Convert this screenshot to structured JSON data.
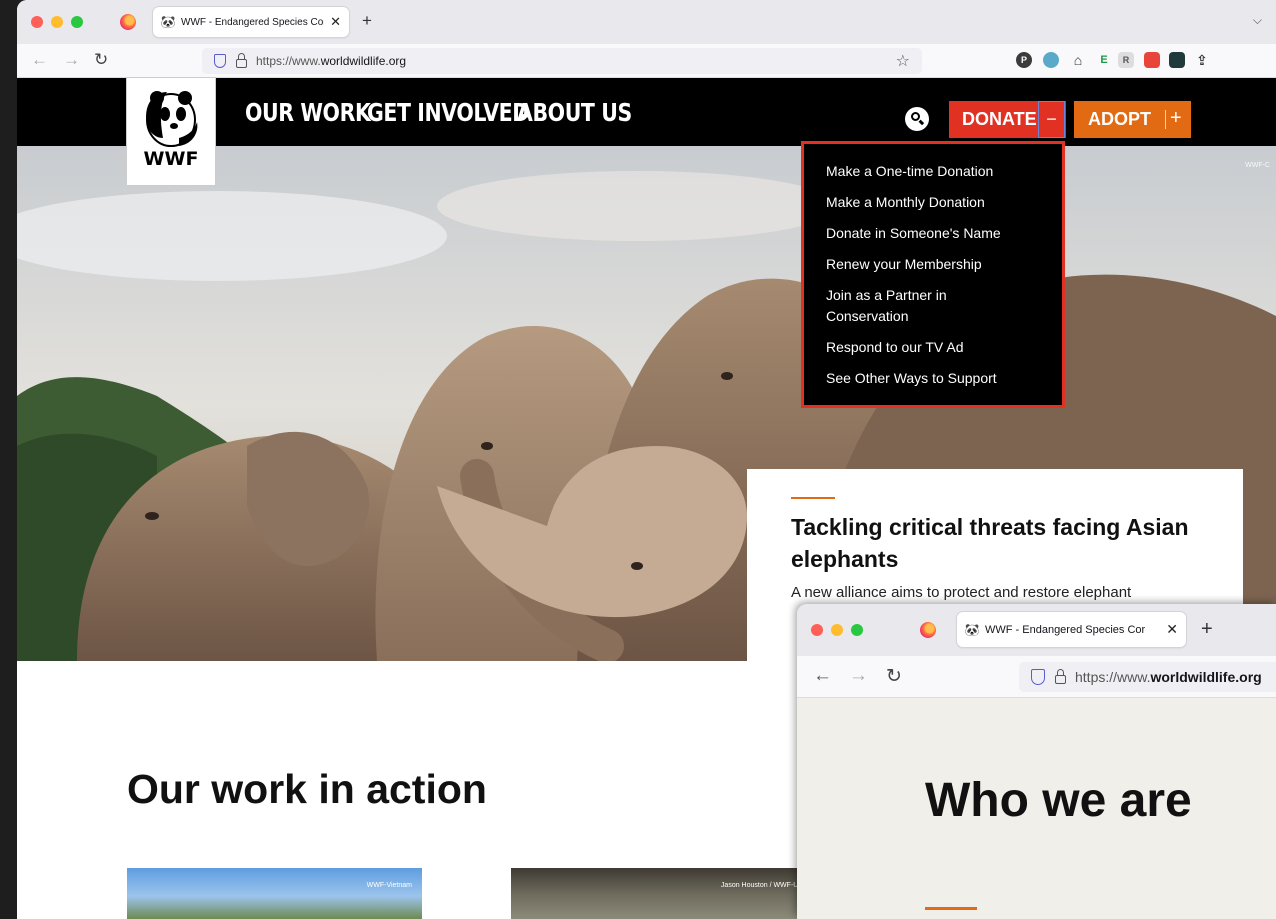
{
  "browser": {
    "tab_title": "WWF - Endangered Species Cor",
    "url_prefix": "https://www.",
    "url_domain": "worldwildlife.org"
  },
  "site": {
    "logo_text": "WWF",
    "nav": [
      "OUR WORK",
      "GET INVOLVED",
      "ABOUT US"
    ],
    "donate_label": "DONATE",
    "donate_toggle": "−",
    "adopt_label": "ADOPT",
    "adopt_toggle": "+",
    "hero_credit": "WWF-C",
    "donate_menu": [
      "Make a One-time Donation",
      "Make a Monthly Donation",
      "Donate in Someone's Name",
      "Renew your Membership",
      "Join as a Partner in Conservation",
      "Respond to our TV Ad",
      "See Other Ways to Support"
    ],
    "feature": {
      "title": "Tackling critical threats facing Asian elephants",
      "description": "A new alliance aims to protect and restore elephant"
    },
    "section_heading": "Our work in action",
    "thumbs": [
      {
        "credit": "WWF-Vietnam"
      },
      {
        "credit": "Jason Houston / WWF-US"
      }
    ]
  },
  "second_window": {
    "tab_title": "WWF - Endangered Species Cor",
    "url_prefix": "https://www.",
    "url_domain": "worldwildlife.org",
    "heading": "Who we are"
  },
  "colors": {
    "donate_red": "#e03123",
    "adopt_orange": "#e26a12",
    "header_black": "#000000"
  },
  "icons": [
    "firefox-icon",
    "panda-favicon",
    "shield-icon",
    "lock-icon",
    "bookmark-star-icon",
    "search-icon"
  ]
}
